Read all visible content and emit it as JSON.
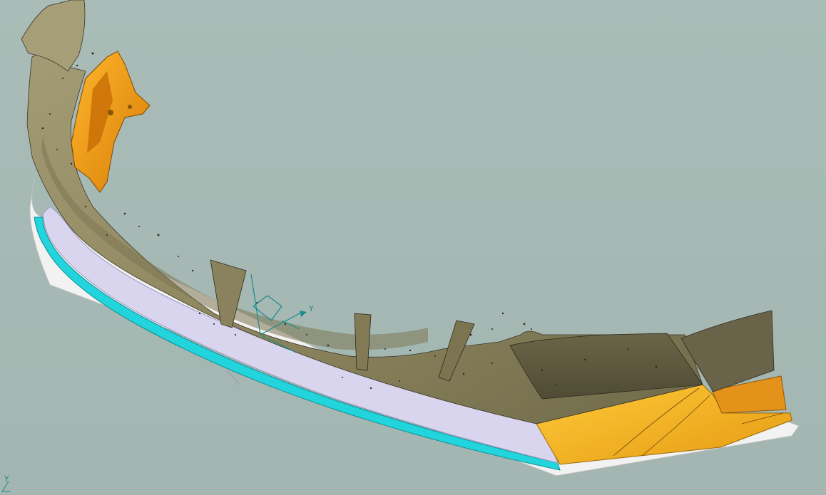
{
  "viewport": {
    "background_color": "#a8bbb6",
    "triad_axis_label": "Y",
    "corner_triad_label": "Y"
  },
  "model": {
    "scan_surface_color": "#8e8660",
    "bracket_color": "#f0a818",
    "lip_face_color": "#d8d4ef",
    "lip_edge_color": "#24d6dc",
    "end_cap_color": "#f2bd2a",
    "rim_color": "#f4f4f4"
  },
  "icons": {
    "triad": "coordinate-axis-triad-icon",
    "corner_triad": "view-orientation-triad-icon"
  }
}
